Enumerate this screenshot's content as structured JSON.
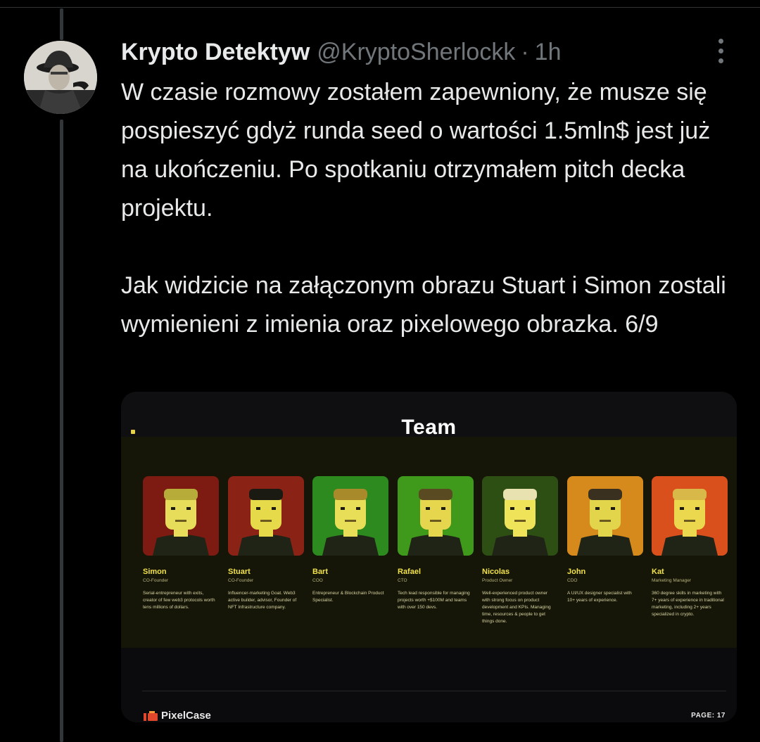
{
  "tweet": {
    "display_name": "Krypto Detektyw",
    "handle": "@KryptoSherlockk",
    "separator": "·",
    "time": "1h",
    "text": "W czasie rozmowy zostałem zapewniony, że musze się pospieszyć gdyż runda seed o wartości 1.5mln$ jest już na ukończeniu. Po spotkaniu otrzymałem pitch decka projektu.\n\nJak widzicie na załączonym obrazu Stuart i Simon zostali wymienieni z imienia oraz pixelowego obrazka. 6/9"
  },
  "icons": {
    "avatar": "detective-avatar",
    "more": "more-options-icon"
  },
  "slide": {
    "title": "Team",
    "brand": "PixelCase",
    "page": "PAGE: 17",
    "members": [
      {
        "name": "Simon",
        "role": "CO-Founder",
        "desc": "Serial-entrepreneur with exits, creator of few web3 protocols worth tens millions of dollars.",
        "bg": "#7d1b12"
      },
      {
        "name": "Stuart",
        "role": "CO-Founder",
        "desc": "Influencer-marketing Goat. Web3 active builder, advisor, Founder of NFT Infrastructure company.",
        "bg": "#8a2316"
      },
      {
        "name": "Bart",
        "role": "COO",
        "desc": "Entrepreneur & Blockchain Product Specialist.",
        "bg": "#2c8a1f"
      },
      {
        "name": "Rafael",
        "role": "CTO",
        "desc": "Tech lead responsible for managing projects worth +$100M and teams with over 150 devs.",
        "bg": "#3f9a1c"
      },
      {
        "name": "Nicolas",
        "role": "Product Owner",
        "desc": "Well-experienced product owner with strong focus on product development and KPIs. Managing time, resources & people to get things done.",
        "bg": "#2e4f14"
      },
      {
        "name": "John",
        "role": "CDO",
        "desc": "A UI/UX designer specialist with 10+ years of experience.",
        "bg": "#d68a1c"
      },
      {
        "name": "Kat",
        "role": "Marketing Manager",
        "desc": "360 degree skills in marketing with 7+ years of experience in traditional marketing, including 2+ years specialized in crypto.",
        "bg": "#d9501c"
      }
    ]
  },
  "colors": {
    "background": "#000000",
    "text": "#e7e9ea",
    "muted": "#71767b",
    "accent_yellow": "#f2e24a"
  }
}
